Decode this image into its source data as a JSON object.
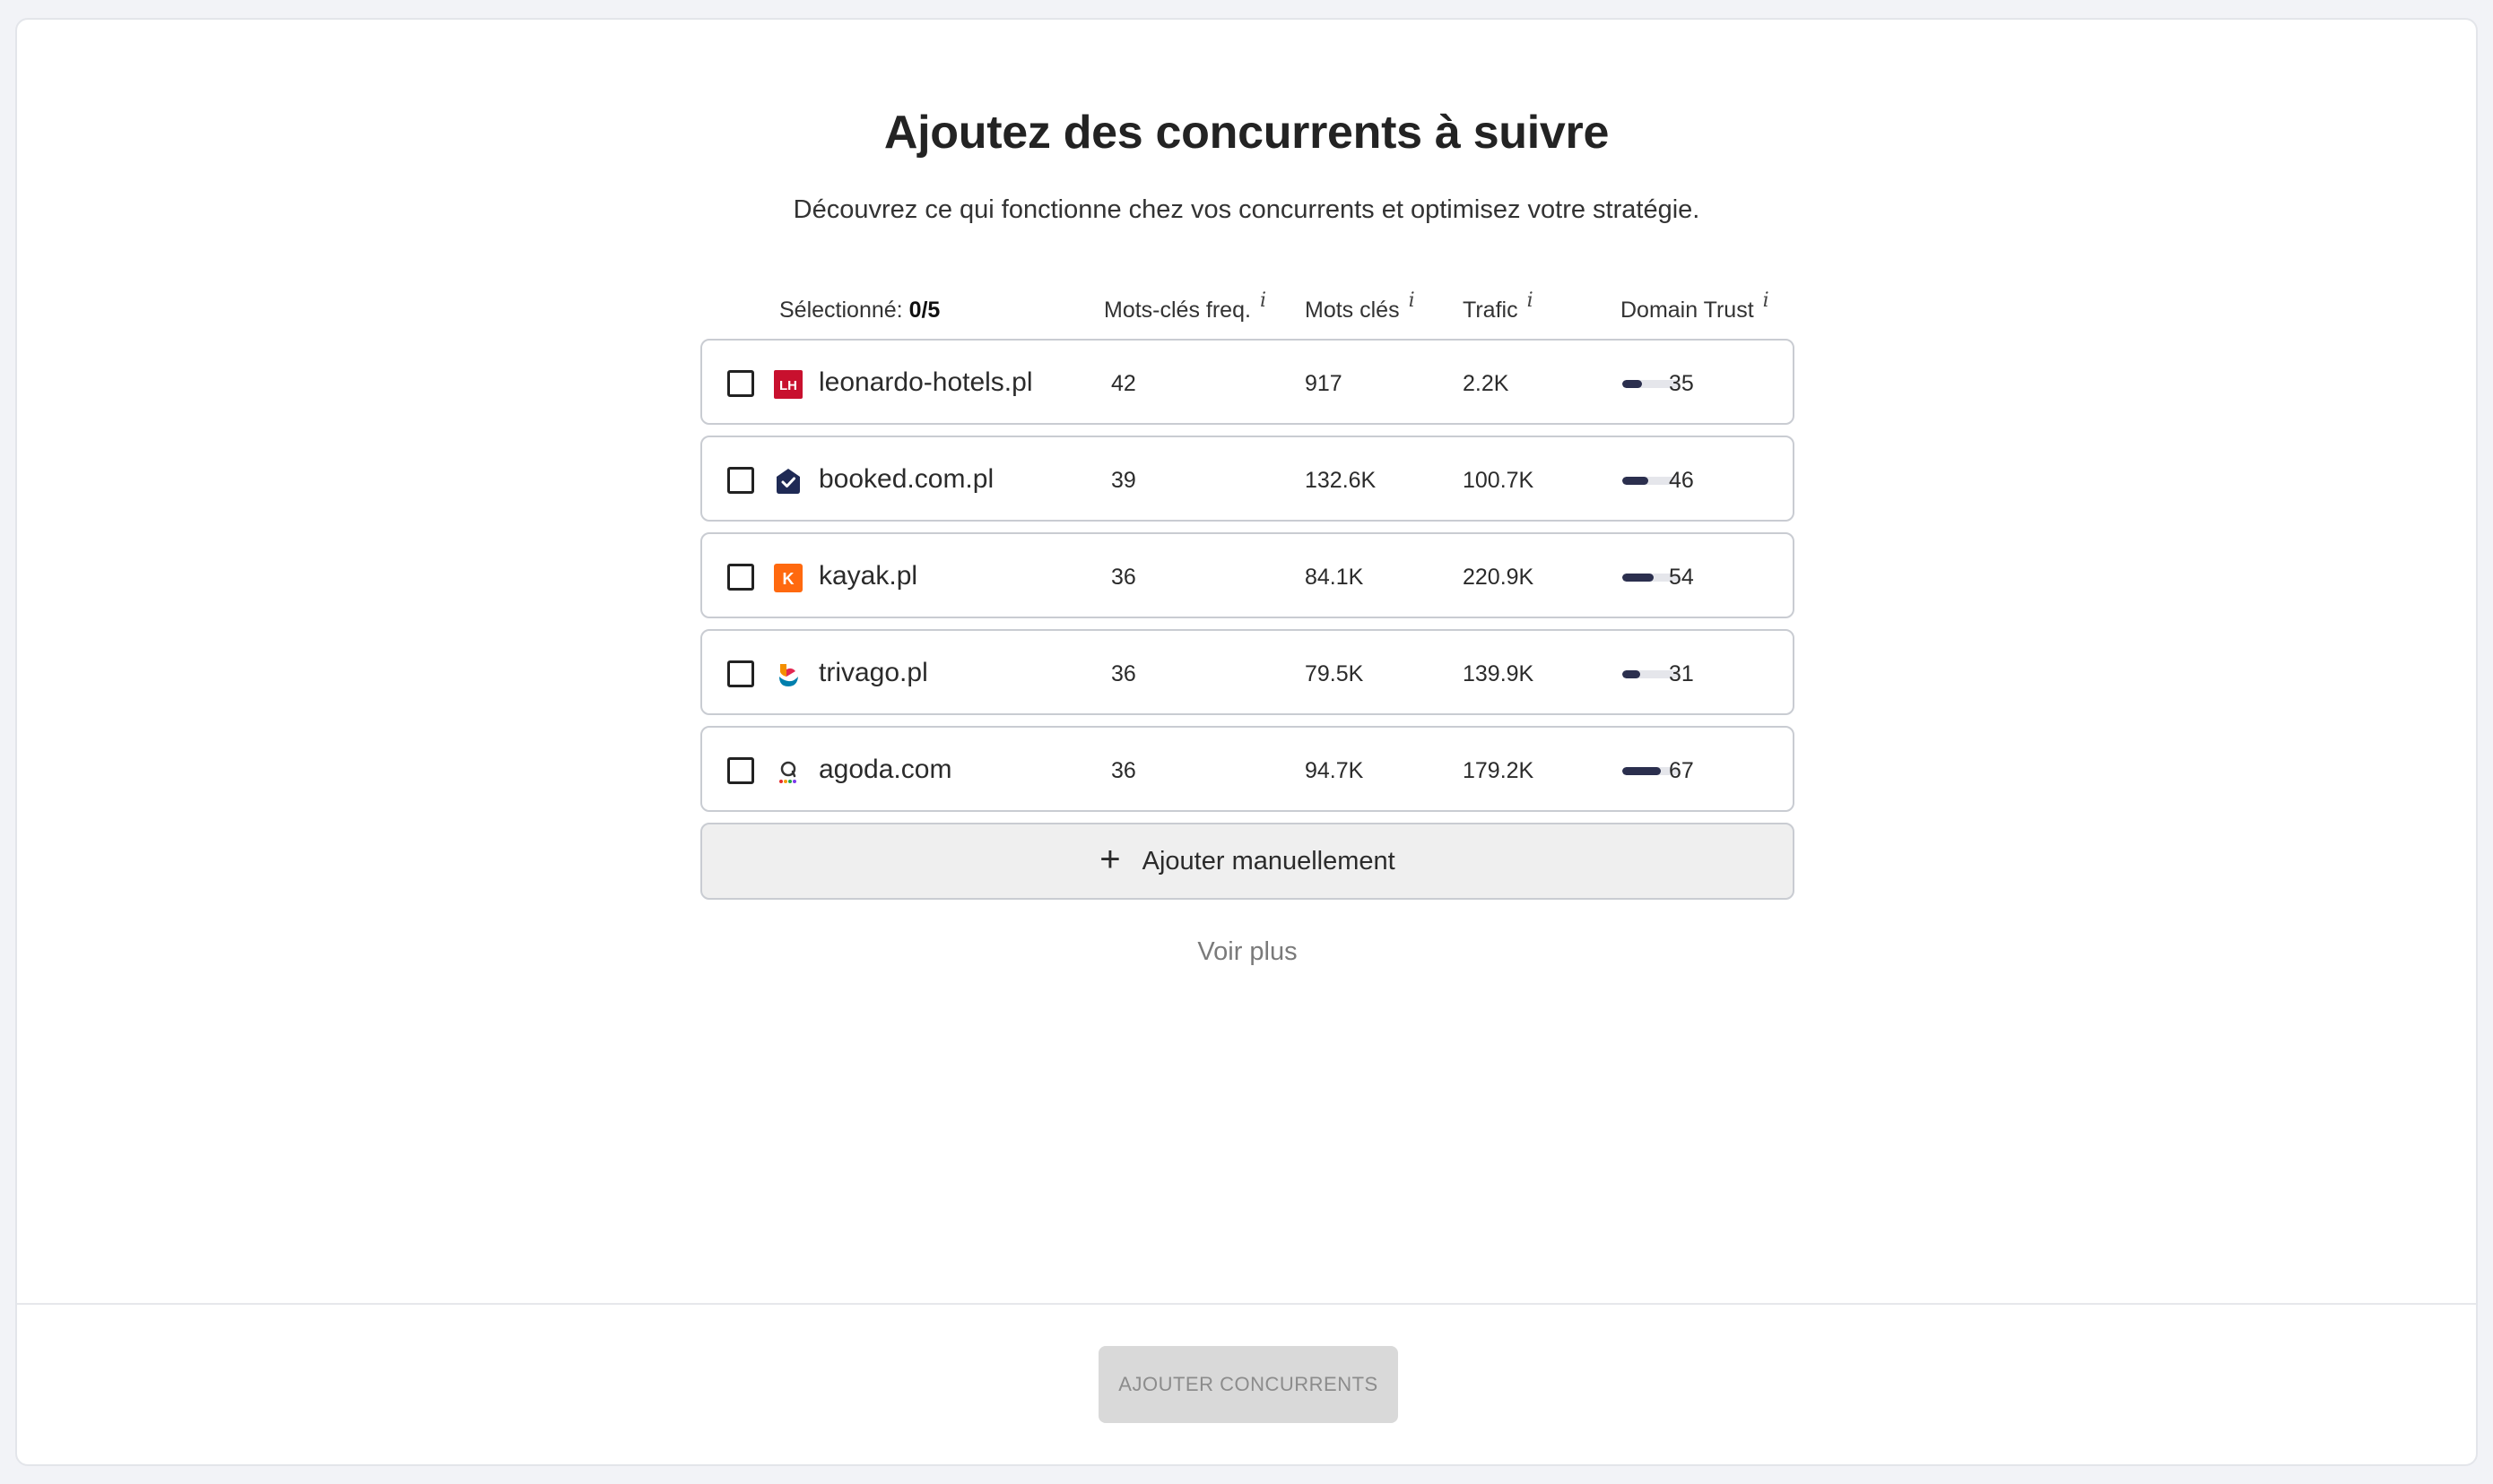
{
  "header": {
    "title": "Ajoutez des concurrents à suivre",
    "subtitle": "Découvrez ce qui fonctionne chez vos concurrents et optimisez votre stratégie."
  },
  "table": {
    "selected_label": "Sélectionné:",
    "selected_count": "0/5",
    "columns": {
      "kw_freq": "Mots-clés freq.",
      "kw": "Mots clés",
      "traffic": "Trafic",
      "domain_trust": "Domain Trust"
    },
    "info_glyph": "i",
    "rows": [
      {
        "domain": "leonardo-hotels.pl",
        "kw_freq": "42",
        "kw": "917",
        "traffic": "2.2K",
        "dt": "35",
        "logo_text": "LH",
        "logo_color": "#c8102e"
      },
      {
        "domain": "booked.com.pl",
        "kw_freq": "39",
        "kw": "132.6K",
        "traffic": "100.7K",
        "dt": "46",
        "logo_color": "#1f2a55"
      },
      {
        "domain": "kayak.pl",
        "kw_freq": "36",
        "kw": "84.1K",
        "traffic": "220.9K",
        "dt": "54",
        "logo_text": "K",
        "logo_color": "#ff690f"
      },
      {
        "domain": "trivago.pl",
        "kw_freq": "36",
        "kw": "79.5K",
        "traffic": "139.9K",
        "dt": "31",
        "logo_color": "#e32851"
      },
      {
        "domain": "agoda.com",
        "kw_freq": "36",
        "kw": "94.7K",
        "traffic": "179.2K",
        "dt": "67",
        "logo_color": "#333333"
      }
    ]
  },
  "actions": {
    "add_manual_label": "Ajouter manuellement",
    "add_manual_icon": "+",
    "see_more_label": "Voir plus",
    "submit_label": "AJOUTER CONCURRENTS"
  }
}
